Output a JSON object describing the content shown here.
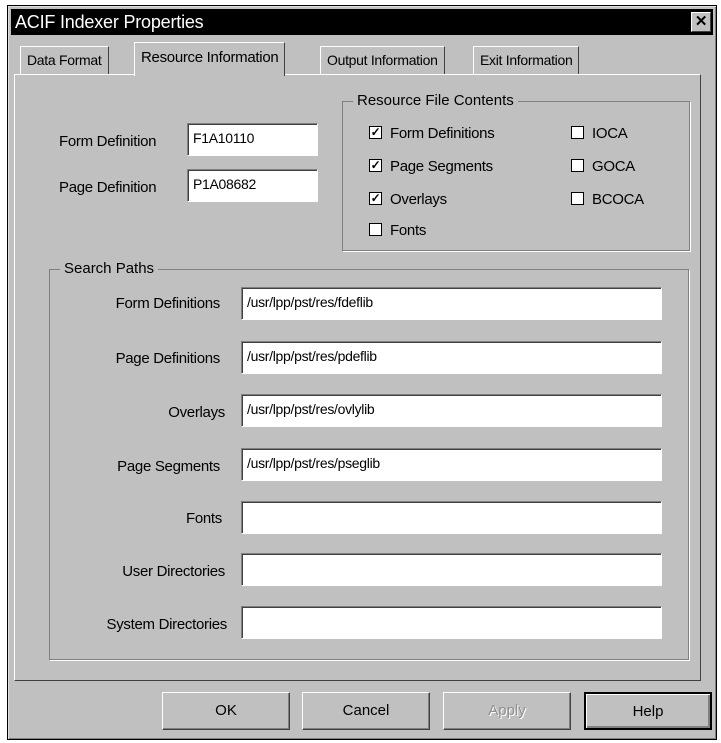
{
  "window": {
    "title": "ACIF Indexer Properties",
    "close_glyph": "✕"
  },
  "tabs": [
    {
      "label": "Data Format"
    },
    {
      "label": "Resource Information"
    },
    {
      "label": "Output Information"
    },
    {
      "label": "Exit Information"
    }
  ],
  "definitions": {
    "form_label": "Form Definition",
    "form_value": "F1A10110",
    "page_label": "Page Definition",
    "page_value": "P1A08682"
  },
  "resource_file_contents": {
    "title": "Resource File Contents",
    "items": [
      {
        "label": "Form Definitions",
        "checked": true
      },
      {
        "label": "Page Segments",
        "checked": true
      },
      {
        "label": "Overlays",
        "checked": true
      },
      {
        "label": "Fonts",
        "checked": false
      },
      {
        "label": "IOCA",
        "checked": false
      },
      {
        "label": "GOCA",
        "checked": false
      },
      {
        "label": "BCOCA",
        "checked": false
      }
    ]
  },
  "search_paths": {
    "title": "Search Paths",
    "rows": [
      {
        "label": "Form Definitions",
        "value": "/usr/lpp/pst/res/fdeflib"
      },
      {
        "label": "Page Definitions",
        "value": "/usr/lpp/pst/res/pdeflib"
      },
      {
        "label": "Overlays",
        "value": "/usr/lpp/pst/res/ovlylib"
      },
      {
        "label": "Page Segments",
        "value": "/usr/lpp/pst/res/pseglib"
      },
      {
        "label": "Fonts",
        "value": ""
      },
      {
        "label": "User Directories",
        "value": ""
      },
      {
        "label": "System Directories",
        "value": ""
      }
    ]
  },
  "buttons": {
    "ok": "OK",
    "cancel": "Cancel",
    "apply": "Apply",
    "help": "Help"
  },
  "check_mark": "✓"
}
